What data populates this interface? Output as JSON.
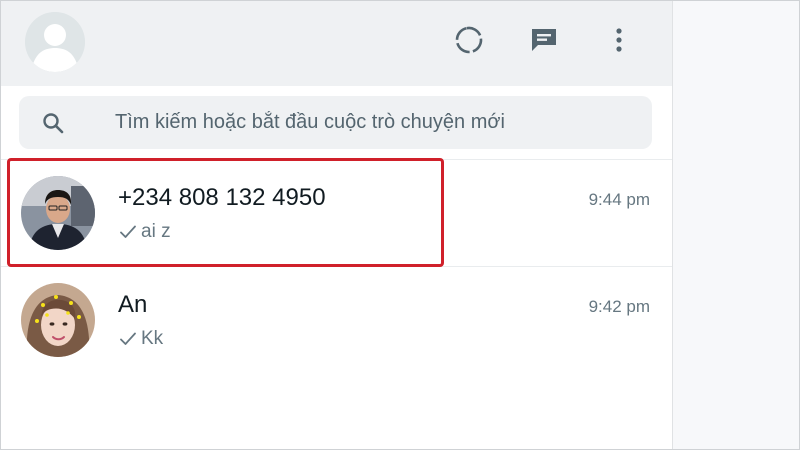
{
  "header": {
    "my_avatar_icon": "default-user-avatar-icon",
    "icons": [
      "status-icon",
      "new-chat-icon",
      "menu-icon"
    ]
  },
  "search": {
    "placeholder": "Tìm kiếm hoặc bắt đầu cuộc trò chuyện mới",
    "value": ""
  },
  "chats": [
    {
      "name": "+234 808 132 4950",
      "time": "9:44 pm",
      "preview": "ai z",
      "status": "sent-single-tick"
    },
    {
      "name": "An",
      "time": "9:42 pm",
      "preview": "Kk",
      "status": "sent-single-tick"
    }
  ],
  "annotation": {
    "highlight_color": "#d0202a"
  },
  "colors": {
    "header_bg": "#eff1f3",
    "icon": "#54656f",
    "name_text": "#111b21",
    "secondary_text": "#667781"
  }
}
